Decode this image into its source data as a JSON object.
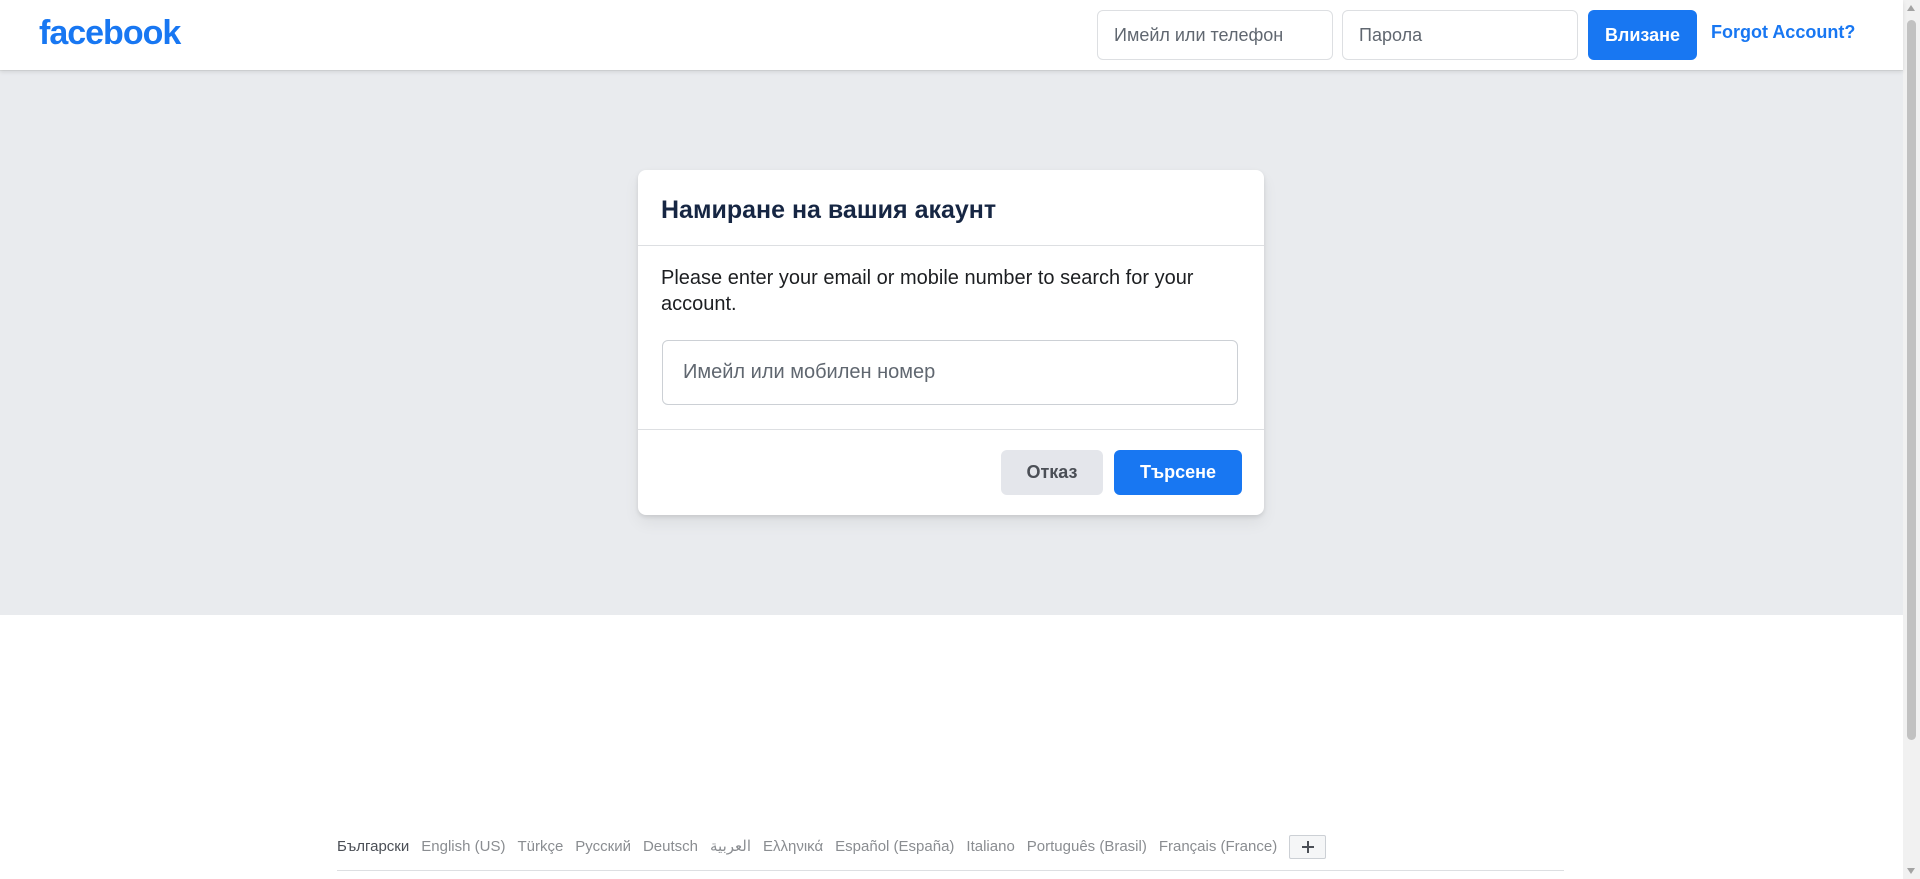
{
  "header": {
    "logo_text": "facebook",
    "email_placeholder": "Имейл или телефон",
    "password_placeholder": "Парола",
    "login_label": "Влизане",
    "forgot_label": "Forgot Account?"
  },
  "card": {
    "title": "Намиране на вашия акаунт",
    "instruction": "Please enter your email or mobile number to search for your account.",
    "input_placeholder": "Имейл или мобилен номер",
    "cancel_label": "Отказ",
    "search_label": "Търсене"
  },
  "footer": {
    "languages": [
      {
        "label": "Български",
        "current": true
      },
      {
        "label": "English (US)"
      },
      {
        "label": "Türkçe"
      },
      {
        "label": "Русский"
      },
      {
        "label": "Deutsch"
      },
      {
        "label": "العربية"
      },
      {
        "label": "Ελληνικά"
      },
      {
        "label": "Español (España)"
      },
      {
        "label": "Italiano"
      },
      {
        "label": "Português (Brasil)"
      },
      {
        "label": "Français (France)"
      }
    ],
    "more_icon": "plus-icon"
  },
  "colors": {
    "brand": "#1877f2",
    "page_background": "#e9ebee",
    "card_title": "#162643",
    "cancel_background": "#e4e6eb"
  }
}
